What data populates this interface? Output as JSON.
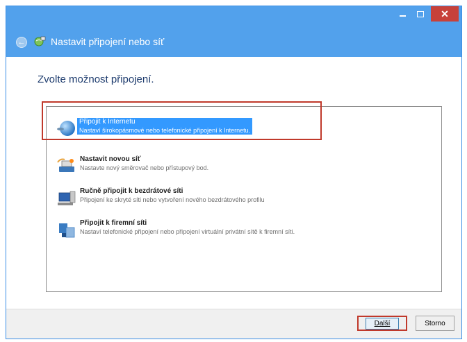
{
  "window": {
    "title": "Nastavit připojení nebo síť"
  },
  "heading": "Zvolte možnost připojení.",
  "options": [
    {
      "title": "Připojit k Internetu",
      "desc": "Nastaví širokopásmové nebo telefonické připojení k Internetu."
    },
    {
      "title": "Nastavit novou síť",
      "desc": "Nastavte nový směrovač nebo přístupový bod."
    },
    {
      "title": "Ručně připojit k bezdrátové síti",
      "desc": "Připojení ke skryté síti nebo vytvoření nového bezdrátového profilu"
    },
    {
      "title": "Připojit k firemní síti",
      "desc": "Nastaví telefonické připojení nebo připojení virtuální privátní sítě k firemní síti."
    }
  ],
  "buttons": {
    "next": "Další",
    "cancel": "Storno"
  },
  "colors": {
    "titlebar": "#52a1ec",
    "selection": "#3399ff",
    "highlight": "#c0392b",
    "close": "#c7413a"
  }
}
